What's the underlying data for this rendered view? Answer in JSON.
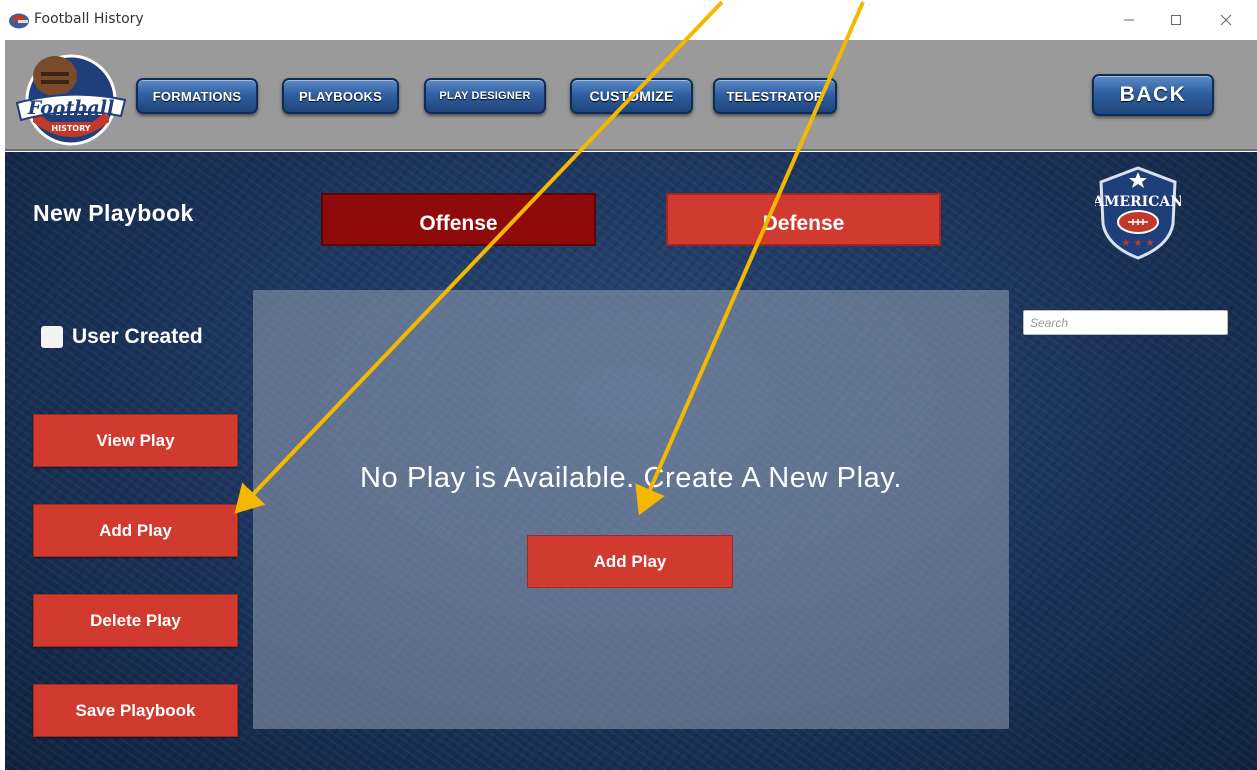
{
  "window": {
    "title": "Football History",
    "icon": "football-helmet-icon",
    "controls": [
      "minimize-icon",
      "maximize-icon",
      "close-icon"
    ]
  },
  "header": {
    "logo": "football-history-logo",
    "nav": {
      "formations": "FORMATIONS",
      "playbooks": "PLAYBOOKS",
      "play_designer": "PLAY DESIGNER",
      "customize": "CUSTOMIZE",
      "telestrator": "TELESTRATOR"
    },
    "back": "BACK"
  },
  "main": {
    "playbook_title": "New Playbook",
    "tabs": {
      "offense": "Offense",
      "defense": "Defense",
      "selected": "offense"
    },
    "user_created": {
      "label": "User Created",
      "checked": false
    },
    "sidebar": {
      "view_play": "View Play",
      "add_play": "Add Play",
      "delete_play": "Delete Play",
      "save_playbook": "Save Playbook"
    },
    "panel": {
      "message": "No Play is Available. Create A New Play.",
      "add_play": "Add Play"
    },
    "search": {
      "placeholder": "Search",
      "value": ""
    },
    "badge_icon": "american-football-shield-icon"
  },
  "colors": {
    "nav_blue": "#2f5fa1",
    "button_red": "#d13a2e",
    "tab_selected": "#8f0a0a",
    "header_gray": "#9a9a9a",
    "background_navy": "#1b335a",
    "annotation_arrow": "#f5b800"
  }
}
